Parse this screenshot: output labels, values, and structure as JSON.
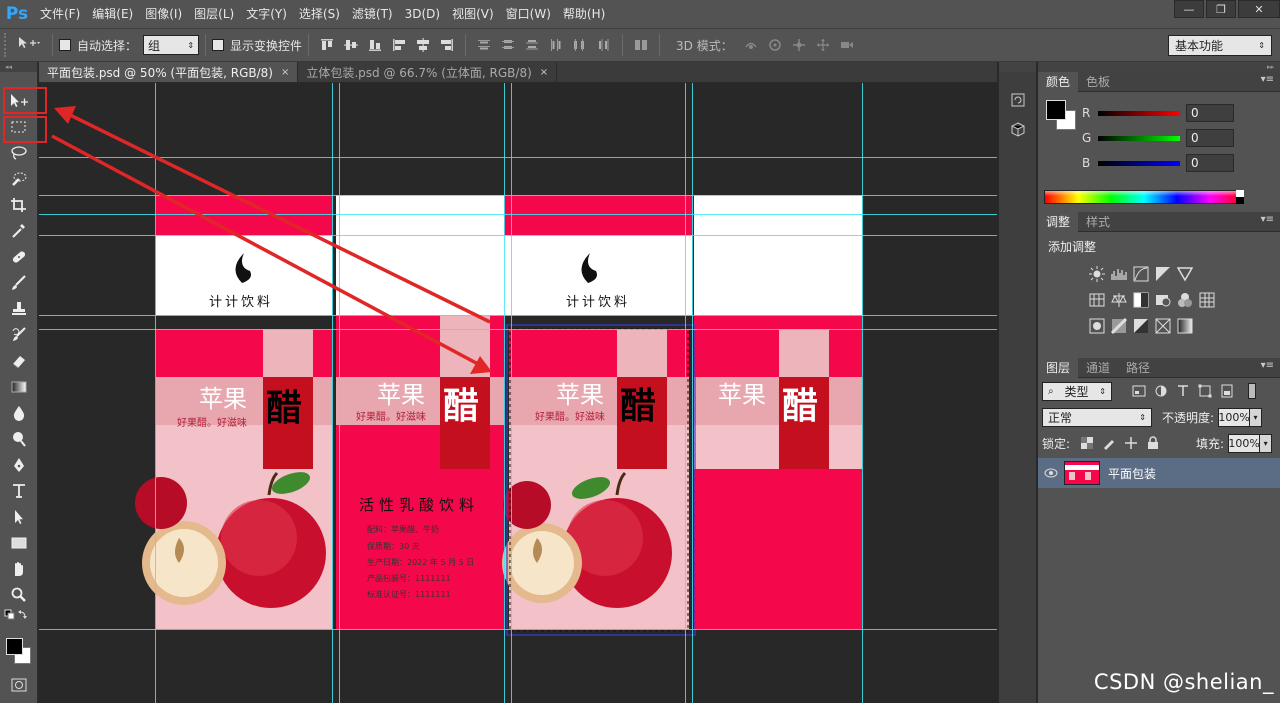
{
  "app": {
    "logo": "Ps"
  },
  "menu": [
    "文件(F)",
    "编辑(E)",
    "图像(I)",
    "图层(L)",
    "文字(Y)",
    "选择(S)",
    "滤镜(T)",
    "3D(D)",
    "视图(V)",
    "窗口(W)",
    "帮助(H)"
  ],
  "window": {
    "minimize": "—",
    "restore": "❐",
    "close": "✕"
  },
  "options": {
    "auto_select_label": "自动选择：",
    "auto_select_value": "组",
    "show_transform_label": "显示变换控件",
    "mode_3d_label": "3D 模式：",
    "workspace": "基本功能"
  },
  "doc_tabs": [
    {
      "label": "平面包装.psd @ 50% (平面包装, RGB/8)",
      "close": "×",
      "active": true
    },
    {
      "label": "立体包装.psd @ 66.7% (立体面, RGB/8)",
      "close": "×",
      "active": false
    }
  ],
  "artwork": {
    "brand": "计计饮料",
    "product_name": "苹果",
    "big_char": "醋",
    "slogan": "好果醋。好滋味",
    "info_title": "活性乳酸饮料",
    "info_lines": [
      "配料：苹果醋、牛奶",
      "保质期：30 天",
      "生产日期：2022 年 5 月 5 日",
      "产品包装号：1111111",
      "标准认证号：1111111"
    ]
  },
  "color_panel": {
    "tabs": [
      "颜色",
      "色板"
    ],
    "channels": [
      {
        "label": "R",
        "value": "0"
      },
      {
        "label": "G",
        "value": "0"
      },
      {
        "label": "B",
        "value": "0"
      }
    ]
  },
  "adjust_panel": {
    "tabs": [
      "调整",
      "样式"
    ],
    "title": "添加调整"
  },
  "layers_panel": {
    "tabs": [
      "图层",
      "通道",
      "路径"
    ],
    "filter_kind": "类型",
    "blend_mode": "正常",
    "opacity_label": "不透明度:",
    "opacity_value": "100%",
    "lock_label": "锁定:",
    "fill_label": "填充:",
    "fill_value": "100%",
    "layer_name": "平面包装"
  },
  "watermark": "CSDN @shelian_",
  "colors": {
    "accent_pink": "#f5084b",
    "light_pink": "#f3c2c8",
    "mid_pink": "#e8a6ae",
    "dark_red": "#c4101e",
    "guide": "#3fe7f0",
    "annotation": "#e02626"
  }
}
